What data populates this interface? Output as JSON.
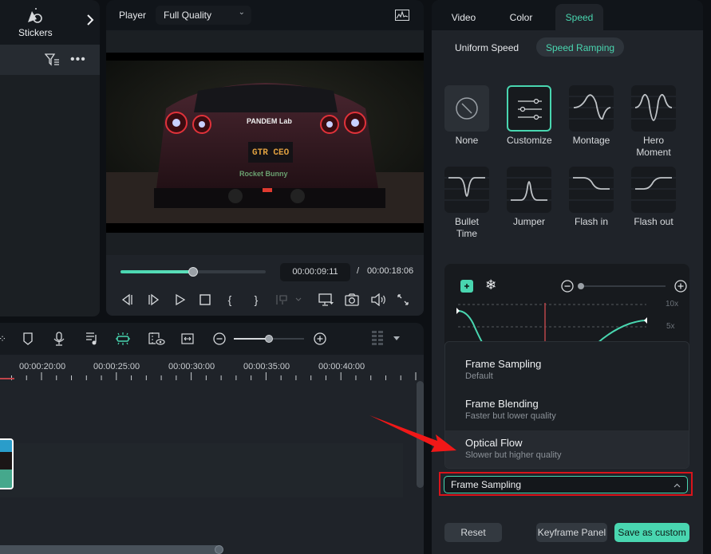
{
  "left_panel": {
    "stickers_label": "Stickers",
    "icons": [
      "stickers-icon",
      "chevron-right-icon",
      "filter-icon",
      "more-icon"
    ]
  },
  "player": {
    "label": "Player",
    "quality": "Full Quality",
    "current_time": "00:00:09:11",
    "separator": "/",
    "total_time": "00:00:18:06",
    "progress": 0.5,
    "video_text": {
      "plate": "GTR CEO",
      "sticker_brand": "PANDEM Lab",
      "sticker_rb": "Rocket Bunny"
    }
  },
  "timeline": {
    "ruler_labels": [
      "00:00:20:00",
      "00:00:25:00",
      "00:00:30:00",
      "00:00:35:00",
      "00:00:40:00"
    ],
    "zoom_level": 0.5
  },
  "right_panel": {
    "tabs": [
      {
        "label": "Video",
        "active": false
      },
      {
        "label": "Color",
        "active": false
      },
      {
        "label": "Speed",
        "active": true
      }
    ],
    "speed_modes": [
      {
        "label": "Uniform Speed",
        "active": false
      },
      {
        "label": "Speed Ramping",
        "active": true
      }
    ],
    "presets": [
      {
        "label": "None"
      },
      {
        "label": "Customize"
      },
      {
        "label": "Montage"
      },
      {
        "label": "Hero Moment"
      },
      {
        "label": "Bullet Time"
      },
      {
        "label": "Jumper"
      },
      {
        "label": "Flash in"
      },
      {
        "label": "Flash out"
      }
    ],
    "selected_preset": "Customize",
    "graph": {
      "labels": {
        "top": "10x",
        "mid": "5x"
      },
      "zoom": 0.0
    },
    "dropdown_options": [
      {
        "title": "Frame Sampling",
        "subtitle": "Default"
      },
      {
        "title": "Frame Blending",
        "subtitle": "Faster but lower quality"
      },
      {
        "title": "Optical Flow",
        "subtitle": "Slower but higher quality"
      }
    ],
    "selected_option": "Frame Sampling",
    "buttons": {
      "reset": "Reset",
      "keyframe": "Keyframe Panel",
      "save": "Save as custom"
    }
  },
  "colors": {
    "accent": "#49d6b0",
    "highlight_box": "#d9141b",
    "playhead": "#c0444a"
  }
}
